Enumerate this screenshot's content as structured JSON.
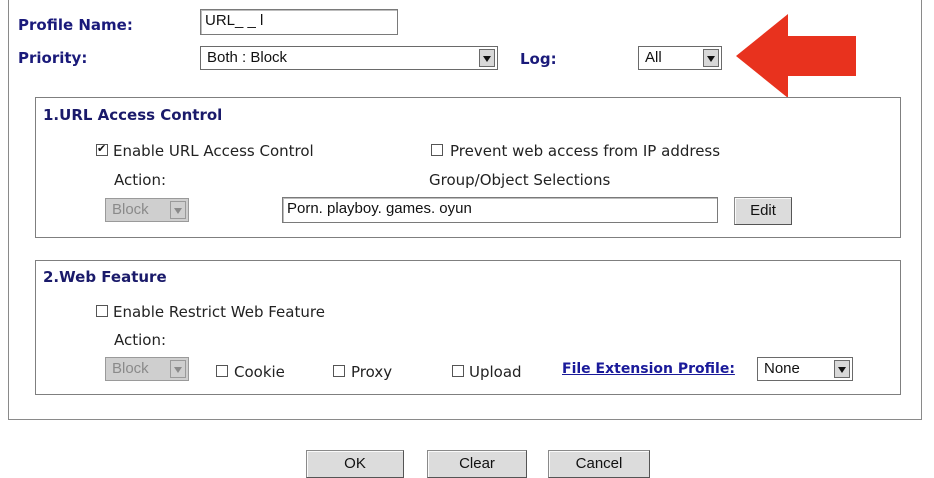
{
  "profile": {
    "name_label": "Profile Name:",
    "name_value": "URL_     _    l",
    "priority_label": "Priority:",
    "priority_value": "Both : Block",
    "log_label": "Log:",
    "log_value": "All"
  },
  "url_access": {
    "title": "1.URL Access Control",
    "enable_label": "Enable URL Access Control",
    "enable_checked": true,
    "prevent_label": "Prevent web access from IP address",
    "prevent_checked": false,
    "action_label": "Action:",
    "action_value": "Block",
    "group_label": "Group/Object Selections",
    "group_value": "Porn. playboy. games. oyun",
    "edit_label": "Edit"
  },
  "web_feature": {
    "title": "2.Web Feature",
    "enable_label": "Enable Restrict Web Feature",
    "enable_checked": false,
    "action_label": "Action:",
    "action_value": "Block",
    "cookie_label": "Cookie",
    "proxy_label": "Proxy",
    "upload_label": "Upload",
    "file_ext_label": "File Extension Profile:",
    "file_ext_value": "None"
  },
  "buttons": {
    "ok": "OK",
    "clear": "Clear",
    "cancel": "Cancel"
  },
  "annotation": {
    "arrow_color": "#e8321e",
    "arrow_icon": "red-arrow-left-icon"
  }
}
